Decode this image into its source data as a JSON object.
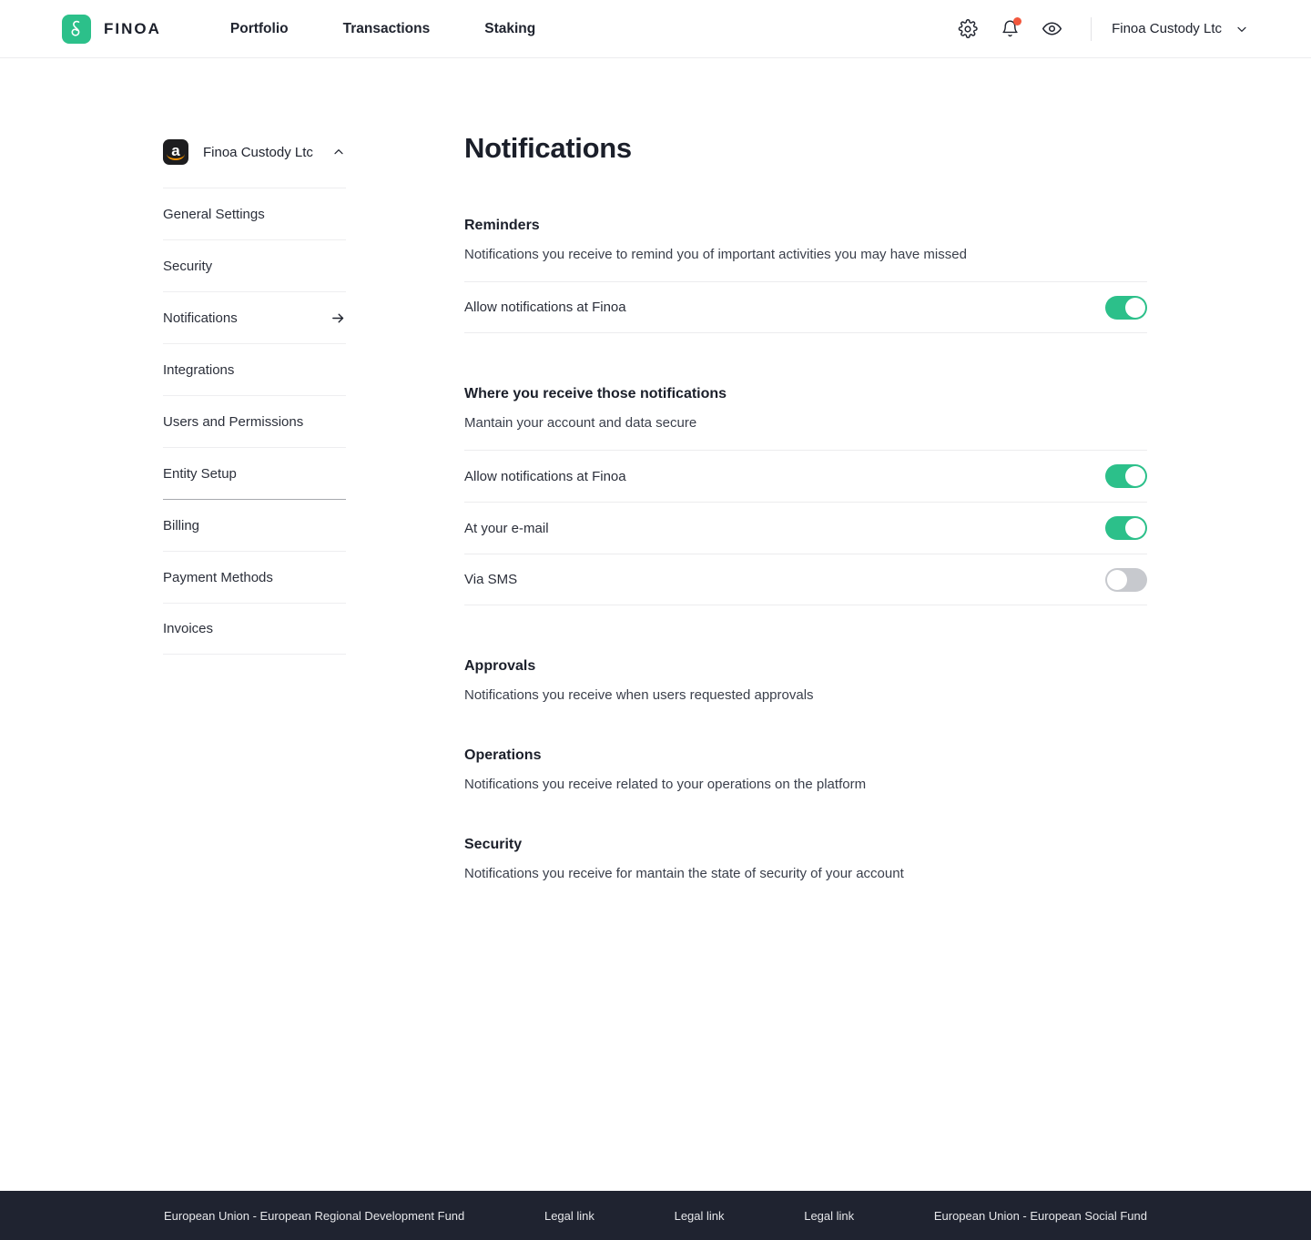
{
  "topnav": {
    "brand": {
      "logo_icon": "finoa-logo-icon",
      "wordmark": "FINOA"
    },
    "links": [
      {
        "label": "Portfolio"
      },
      {
        "label": "Transactions"
      },
      {
        "label": "Staking"
      }
    ],
    "icons": [
      {
        "name": "gear-icon"
      },
      {
        "name": "bell-icon",
        "has_badge": true,
        "badge_color": "#f2573d"
      },
      {
        "name": "eye-icon"
      }
    ],
    "account": {
      "name": "Finoa Custody Ltc",
      "caret_icon": "chevron-down-icon"
    }
  },
  "sidebar": {
    "org": {
      "avatar_icon": "amazon-avatar-icon",
      "avatar_letter": "a",
      "name": "Finoa Custody Ltc",
      "caret_icon": "chevron-up-icon"
    },
    "items": [
      {
        "label": "General Settings",
        "active": false
      },
      {
        "label": "Security",
        "active": false
      },
      {
        "label": "Notifications",
        "active": true,
        "arrow_icon": "arrow-right-icon"
      },
      {
        "label": "Integrations",
        "active": false
      },
      {
        "label": "Users and Permissions",
        "active": false
      },
      {
        "label": "Entity Setup",
        "active": false
      },
      {
        "label": "Billing",
        "active": false
      },
      {
        "label": "Payment Methods",
        "active": false
      },
      {
        "label": "Invoices",
        "active": false
      }
    ]
  },
  "main": {
    "title": "Notifications",
    "sections": [
      {
        "key": "reminders",
        "title": "Reminders",
        "description": "Notifications you receive to remind you of important activities you may have missed",
        "toggles": [
          {
            "label": "Allow notifications at Finoa",
            "on": true
          }
        ]
      },
      {
        "key": "where",
        "title": "Where you receive those notifications",
        "description": "Mantain your account and data secure",
        "toggles": [
          {
            "label": "Allow notifications at Finoa",
            "on": true
          },
          {
            "label": "At your e-mail",
            "on": true
          },
          {
            "label": "Via SMS",
            "on": false
          }
        ]
      },
      {
        "key": "approvals",
        "title": "Approvals",
        "description": "Notifications you receive when users requested approvals",
        "toggles": []
      },
      {
        "key": "operations",
        "title": "Operations",
        "description": "Notifications you receive related to your operations on the platform",
        "toggles": []
      },
      {
        "key": "security",
        "title": "Security",
        "description": "Notifications you receive for mantain the state of security of your account",
        "toggles": []
      }
    ]
  },
  "footer": {
    "items": [
      {
        "label": "European Union - European Regional Development Fund",
        "link": false
      },
      {
        "label": "Legal link",
        "link": true
      },
      {
        "label": "Legal link",
        "link": true
      },
      {
        "label": "Legal link",
        "link": true
      },
      {
        "label": "European Union - European Social Fund",
        "link": false
      }
    ]
  },
  "colors": {
    "accent_green": "#2cc08a",
    "badge_red": "#f2573d",
    "footer_bg": "#1f2330",
    "text_dark": "#1b1f2a"
  }
}
